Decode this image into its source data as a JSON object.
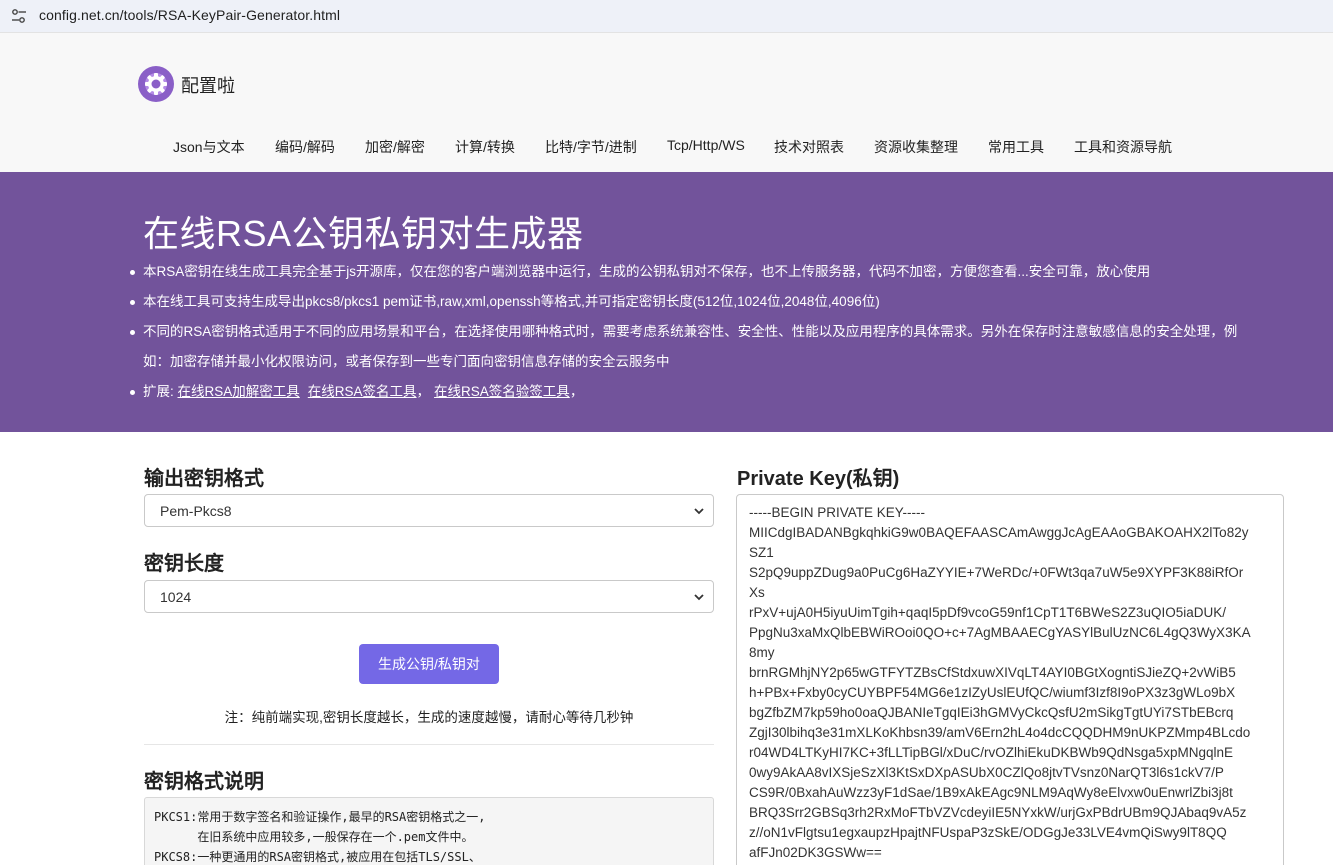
{
  "browser": {
    "url": "config.net.cn/tools/RSA-KeyPair-Generator.html"
  },
  "header": {
    "brand": "配置啦",
    "nav": [
      {
        "label": "Json与文本"
      },
      {
        "label": "编码/解码"
      },
      {
        "label": "加密/解密"
      },
      {
        "label": "计算/转换"
      },
      {
        "label": "比特/字节/进制"
      },
      {
        "label": "Tcp/Http/WS"
      },
      {
        "label": "技术对照表"
      },
      {
        "label": "资源收集整理"
      },
      {
        "label": "常用工具"
      },
      {
        "label": "工具和资源导航"
      }
    ]
  },
  "hero": {
    "title": "在线RSA公钥私钥对生成器",
    "bullet1": "本RSA密钥在线生成工具完全基于js开源库，仅在您的客户端浏览器中运行，生成的公钥私钥对不保存，也不上传服务器，代码不加密，方便您查看...安全可靠，放心使用",
    "bullet2": "本在线工具可支持生成导出pkcs8/pkcs1 pem证书,raw,xml,openssh等格式,并可指定密钥长度(512位,1024位,2048位,4096位)",
    "bullet3_line1": "不同的RSA密钥格式适用于不同的应用场景和平台，在选择使用哪种格式时，需要考虑系统兼容性、安全性、性能以及应用程序的具体需求。另外在保存时注意敏感信息的安全处理，例",
    "bullet3_line2": "如：加密存储并最小化权限访问，或者保存到一些专门面向密钥信息存储的安全云服务中",
    "ext_prefix": "扩展: ",
    "links": [
      {
        "label": "在线RSA加解密工具"
      },
      {
        "label": "在线RSA签名工具"
      },
      {
        "label": "在线RSA签名验签工具"
      }
    ],
    "sep1": "，",
    "sep2": "，",
    "sep3": "，"
  },
  "form": {
    "format_title": "输出密钥格式",
    "format_value": "Pem-Pkcs8",
    "length_title": "密钥长度",
    "length_value": "1024",
    "generate_label": "生成公钥/私钥对",
    "note": "注：纯前端实现,密钥长度越长，生成的速度越慢，请耐心等待几秒钟",
    "explain_title": "密钥格式说明",
    "explain_lines": [
      "PKCS1:常用于数字签名和验证操作,最早的RSA密钥格式之一,",
      "      在旧系统中应用较多,一般保存在一个.pem文件中。",
      "PKCS8:一种更通用的RSA密钥格式,被应用在包括TLS/SSL、"
    ]
  },
  "private_key": {
    "title": "Private Key(私钥)",
    "lines": [
      "-----BEGIN PRIVATE KEY-----",
      "MIICdgIBADANBgkqhkiG9w0BAQEFAASCAmAwggJcAgEAAoGBAKOAHX2lTo82y",
      "SZ1",
      "S2pQ9uppZDug9a0PuCg6HaZYYIE+7WeRDc/+0FWt3qa7uW5e9XYPF3K88iRfOr",
      "Xs",
      "rPxV+ujA0H5iyuUimTgih+qaqI5pDf9vcoG59nf1CpT1T6BWeS2Z3uQIO5iaDUK/",
      "PpgNu3xaMxQlbEBWiROoi0QO+c+7AgMBAAECgYASYlBulUzNC6L4gQ3WyX3KA",
      "8my",
      "brnRGMhjNY2p65wGTFYTZBsCfStdxuwXIVqLT4AYI0BGtXogntiSJieZQ+2vWiB5",
      "h+PBx+Fxby0cyCUYBPF54MG6e1zIZyUslEUfQC/wiumf3Izf8I9oPX3z3gWLo9bX",
      "bgZfbZM7kp59ho0oaQJBANIeTgqIEi3hGMVyCkcQsfU2mSikgTgtUYi7STbEBcrq",
      "ZgjI30lbihq3e31mXLKoKhbsn39/amV6Ern2hL4o4dcCQQDHM9nUKPZMmp4BLcdo",
      "r04WD4LTKyHI7KC+3fLLTipBGl/xDuC/rvOZlhiEkuDKBWb9QdNsga5xpMNgqlnE",
      "0wy9AkAA8vIXSjeSzXl3KtSxDXpASUbX0CZlQo8jtvTVsnz0NarQT3l6s1ckV7/P",
      "CS9R/0BxahAuWzz3yF1dSae/1B9xAkEAgc9NLM9AqWy8eElvxw0uEnwrlZbi3j8t",
      "BRQ3Srr2GBSq3rh2RxMoFTbVZVcdeyiIE5NYxkW/urjGxPBdrUBm9QJAbaq9vA5z",
      "z//oN1vFlgtsu1egxaupzHpajtNFUspaP3zSkE/ODGgJe33LVE4vmQiSwy9lT8QQ",
      "afFJn02DK3GSWw=="
    ]
  },
  "colors": {
    "hero_bg": "#72539b",
    "button_bg": "#7468e6",
    "header_bg": "#f8f8f8"
  },
  "icons": {
    "addr": "tune-icon",
    "logo": "gear-logo-icon",
    "select": "chevron-down-icon"
  }
}
